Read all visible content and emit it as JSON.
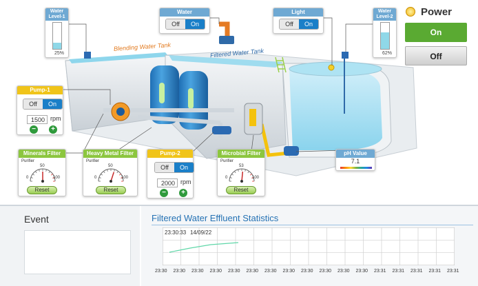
{
  "plant": {
    "blending_tank_label": "Blending Water Tank",
    "filtered_tank_label": "Filtered Water Tank"
  },
  "water_level_1": {
    "title": "Water Level-1",
    "percent_text": "25%",
    "fill_fraction": 0.25
  },
  "water_level_2": {
    "title": "Water Level-2",
    "percent_text": "62%",
    "fill_fraction": 0.62
  },
  "water_switch": {
    "title": "Water",
    "off_label": "Off",
    "on_label": "On",
    "state": "on"
  },
  "light_switch": {
    "title": "Light",
    "off_label": "Off",
    "on_label": "On",
    "state": "on"
  },
  "power": {
    "title": "Power",
    "on_label": "On",
    "off_label": "Off",
    "state": "on"
  },
  "pump1": {
    "title": "Pump-1",
    "off_label": "Off",
    "on_label": "On",
    "rpm_value": "1500",
    "rpm_unit": "rpm"
  },
  "pump2": {
    "title": "Pump-2",
    "off_label": "Off",
    "on_label": "On",
    "rpm_value": "2000",
    "rpm_unit": "rpm"
  },
  "minerals_filter": {
    "title": "Minerals Filter",
    "label": "Purifier",
    "min": "0",
    "mid": "50",
    "max": "100",
    "value": 50,
    "reset_label": "Reset"
  },
  "heavy_metal_filter": {
    "title": "Heavy Metal Filter",
    "label": "Purifier",
    "min": "0",
    "mid": "50",
    "max": "100",
    "value": 60,
    "reset_label": "Reset"
  },
  "microbial_filter": {
    "title": "Microbial Filter",
    "label": "Purifier",
    "min": "0",
    "mid": "53",
    "max": "100",
    "value": 53,
    "reset_label": "Reset"
  },
  "ph": {
    "title": "pH Value",
    "value": "7.1"
  },
  "event": {
    "title": "Event"
  },
  "stats": {
    "title": "Filtered Water Effluent Statistics",
    "timestamp": "23:30:33",
    "date": "14/09/22",
    "x_ticks": [
      "23:30",
      "23:30",
      "23:30",
      "23:30",
      "23:30",
      "23:30",
      "23:30",
      "23:30",
      "23:30",
      "23:30",
      "23:30",
      "23:30",
      "23:31",
      "23:31",
      "23:31",
      "23:31",
      "23:31"
    ]
  },
  "colors": {
    "accent_blue": "#1a7fc8",
    "panel_blue": "#6fa9d3",
    "panel_yellow": "#f0c419",
    "panel_green": "#8cc63f",
    "power_on": "#5aaa32",
    "chart_line": "#5fd7a8"
  }
}
